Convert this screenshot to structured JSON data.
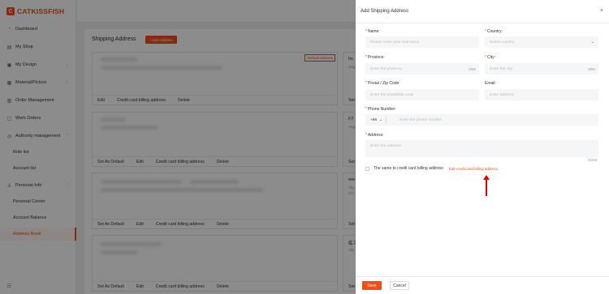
{
  "app": {
    "logo_text": "CATKISSFISH",
    "logo_mark": "C"
  },
  "sidebar": {
    "items": [
      {
        "label": "Dashboard",
        "icon": "dashboard-icon",
        "glyph": "◔"
      },
      {
        "label": "My Shop",
        "icon": "shop-icon",
        "glyph": "▤"
      },
      {
        "label": "My Design",
        "icon": "design-icon",
        "glyph": "▣",
        "chevron": "⌄"
      },
      {
        "label": "Material/Picture",
        "icon": "picture-icon",
        "glyph": "▦",
        "chevron": "⌄"
      },
      {
        "label": "Order Management",
        "icon": "order-icon",
        "glyph": "▥"
      },
      {
        "label": "Work Orders",
        "icon": "work-order-icon",
        "glyph": "▢"
      },
      {
        "label": "Authority management",
        "icon": "authority-icon",
        "glyph": "◎",
        "chevron": "⌃"
      },
      {
        "label": "Role list"
      },
      {
        "label": "Account list"
      },
      {
        "label": "Personal Info",
        "icon": "user-icon",
        "glyph": "♙",
        "chevron": "⌃"
      },
      {
        "label": "Personal Center"
      },
      {
        "label": "Account Balance"
      },
      {
        "label": "Address Book",
        "active": true
      }
    ],
    "menu_toggle": "☰"
  },
  "main": {
    "title": "Shipping Address",
    "add_button": "+Add Address",
    "default_tag": "Default address",
    "cards": [
      {
        "actions": [
          "Edit",
          "Credit card billing address",
          "Delete"
        ]
      },
      {
        "actions": [
          "Set As Default",
          "Edit",
          "Credit card billing address",
          "Delete"
        ]
      },
      {
        "actions": [
          "Set As Default",
          "Edit",
          "Credit card billing address",
          "Delete"
        ]
      },
      {
        "actions": [
          "Set As Default",
          "Edit",
          "Credit card billing address",
          "Delete"
        ]
      }
    ],
    "side_cards": [
      {
        "title": "hs",
        "sub": "Ang",
        "foot": "Set"
      },
      {
        "title": "F7",
        "sub": "Ang",
        "foot": "Set"
      },
      {
        "title": "ww",
        "sub": "Afg",
        "sub2": "Chi",
        "foot": "Set"
      },
      {
        "title": "练习",
        "sub": "Afg",
        "foot": "Set"
      }
    ]
  },
  "drawer": {
    "title": "Add Shipping Address",
    "close": "×",
    "fields": {
      "name": {
        "label": "Name:",
        "placeholder": "Please enter your real name"
      },
      "country": {
        "label": "Country:",
        "placeholder": "Select country"
      },
      "province": {
        "label": "Province:",
        "placeholder": "Enter the province",
        "count": "0/50"
      },
      "city": {
        "label": "City:",
        "placeholder": "Enter the city",
        "count": "0/50"
      },
      "postal": {
        "label": "Postal / Zip Code:",
        "placeholder": "Enter the postal/Zip code"
      },
      "email": {
        "label": "Email:",
        "placeholder": "Enter address"
      },
      "phone": {
        "label": "Phone Number:",
        "code": "+86",
        "placeholder": "Enter the phone number"
      },
      "address": {
        "label": "Address:",
        "placeholder": "Enter the address",
        "count": "0/255"
      }
    },
    "same_as_billing": "The same to credit card billing address",
    "edit_billing_link": "Edit credit card billing address",
    "save": "Save",
    "cancel": "Cancel"
  },
  "colors": {
    "accent": "#f04e1f",
    "annotation_arrow": "#e00000"
  }
}
